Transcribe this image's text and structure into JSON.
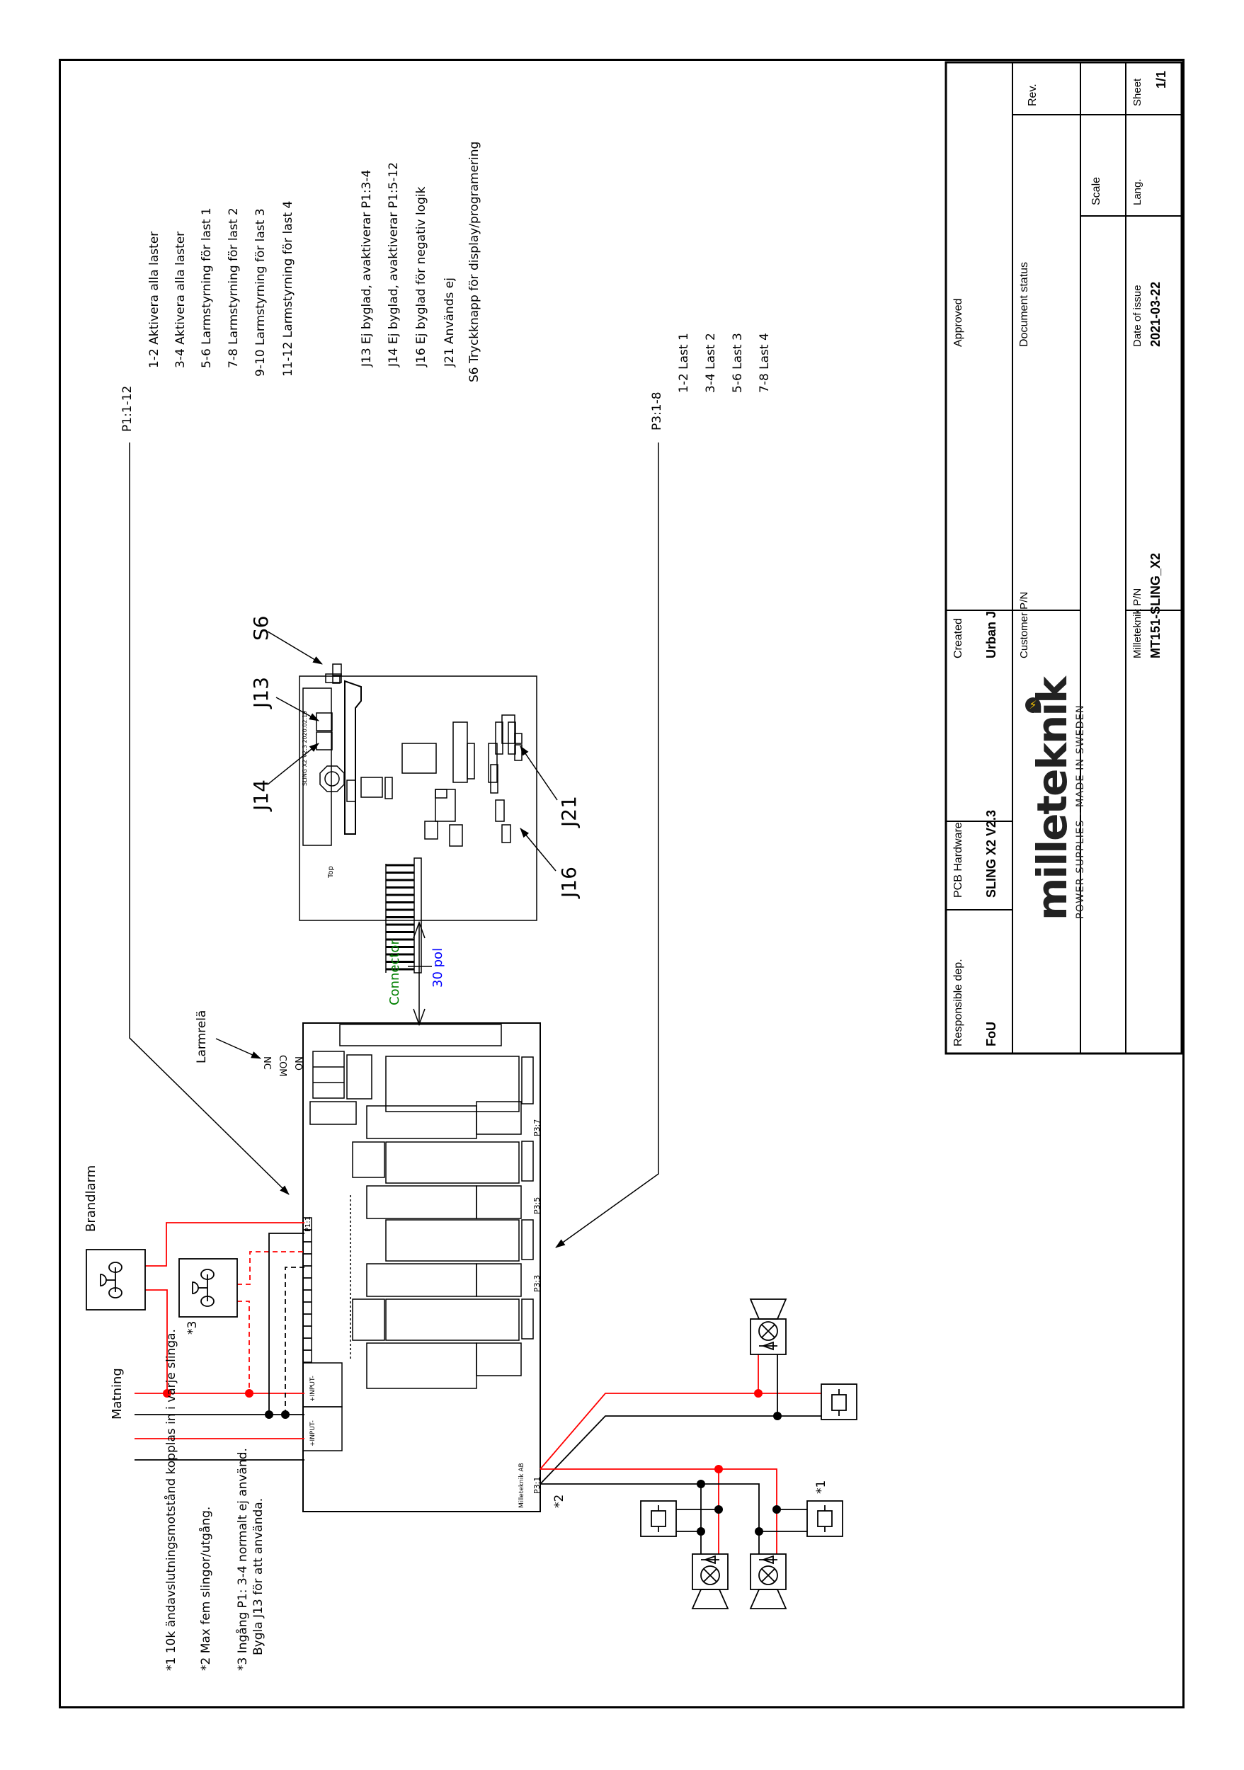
{
  "notes_p1": {
    "header": "P1:1-12",
    "items": [
      "1-2 Aktivera alla laster",
      "3-4  Aktivera alla laster",
      "5-6  Larmstyrning för last 1",
      "7-8  Larmstyrning för last 2",
      "9-10 Larmstyrning för last 3",
      "11-12 Larmstyrning för last 4"
    ]
  },
  "notes_jumpers": {
    "items": [
      "J13 Ej byglad, avaktiverar P1:3-4",
      "J14 Ej byglad, avaktiverar P1:5-12",
      "J16 Ej byglad för negativ logik",
      "J21 Används ej",
      "S6 Tryckknapp för display/programering"
    ]
  },
  "notes_p3": {
    "header": "P3:1-8",
    "items": [
      "1-2 Last 1",
      "3-4 Last 2",
      "5-6 Last 3",
      "7-8 Last 4"
    ]
  },
  "labels": {
    "s6": "S6",
    "j13": "J13",
    "j14": "J14",
    "j21": "J21",
    "j16": "J16",
    "connector": "Connector",
    "pol": "30 pol",
    "larmrela": "Larmrelä",
    "nc": "NC",
    "com": "COM",
    "no": "NO",
    "brandlarm": "Brandlarm",
    "matning": "Matning",
    "star3": "*3",
    "star2": "*2",
    "star1": "*1",
    "top": "Top",
    "p3_7": "P3:7",
    "p3_5": "P3:5",
    "p3_3": "P3:3",
    "p3_1": "P3:1",
    "p1_1": "P1:1",
    "input": "+INPUT-",
    "milleteknik_ab": "Milleteknik AB",
    "sling_rev": "SLING X2 V2.3  2020.02.19"
  },
  "colors": {
    "wire_red": "#ff0000",
    "wire_black": "#000000",
    "connector_green": "#008000",
    "pol_blue": "#0000ff",
    "logo_yellow": "#f5c400"
  },
  "footnotes": [
    "*1 10k ändavslutningsmotstånd kopplas in i varje slinga.",
    "*2 Max fem slingor/utgång.",
    "*3 Ingång P1: 3-4 normalt ej använd.",
    "Bygla J13 för att använda."
  ],
  "title_block": {
    "responsible_label": "Responsible dep.",
    "responsible_value": "FoU",
    "pcb_label": "PCB Hardware",
    "pcb_value": "SLING X2 V2.3",
    "created_label": "Created",
    "created_value": "Urban J",
    "approved_label": "Approved",
    "customer_pn_label": "Customer P/N",
    "doc_status_label": "Document status",
    "rev_label": "Rev.",
    "scale_label": "Scale",
    "mt_pn_label": "Milleteknik P/N",
    "mt_pn_value": "MT151-SLING_X2",
    "date_label": "Date of issue",
    "date_value": "2021-03-22",
    "lang_label": "Lang.",
    "sheet_label": "Sheet",
    "sheet_value": "1/1",
    "logo_text": "milleteknik",
    "logo_tagline": "POWER SUPPLIES - MADE IN SWEDEN"
  }
}
